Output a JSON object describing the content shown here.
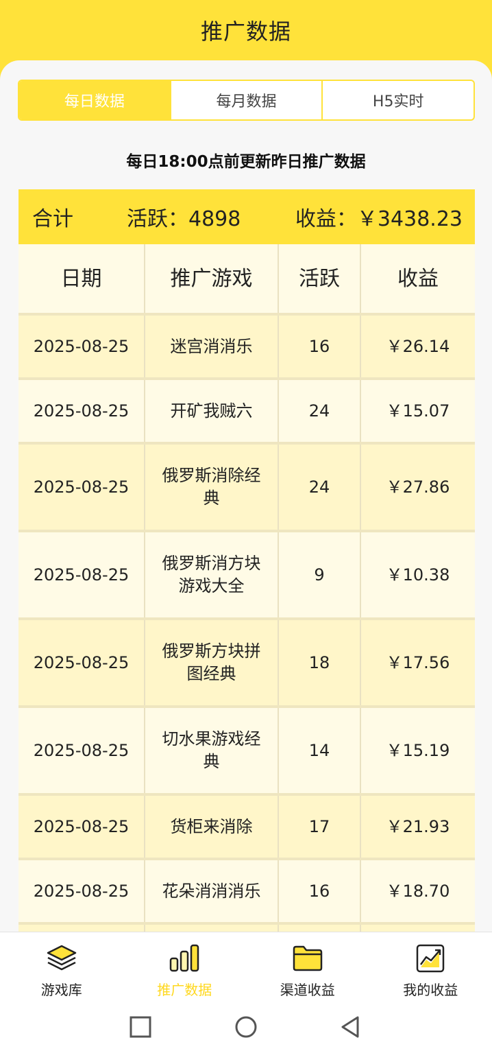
{
  "header": {
    "title": "推广数据"
  },
  "tabs": [
    {
      "label": "每日数据",
      "active": true
    },
    {
      "label": "每月数据",
      "active": false
    },
    {
      "label": "H5实时",
      "active": false
    }
  ],
  "notice": "每日18:00点前更新昨日推广数据",
  "summary": {
    "label": "合计",
    "active": "活跃：4898",
    "income": "收益：￥3438.23"
  },
  "table": {
    "columns": [
      "日期",
      "推广游戏",
      "活跃",
      "收益"
    ],
    "rows": [
      {
        "date": "2025-08-25",
        "game": "迷宫消消乐",
        "active": "16",
        "income": "￥26.14"
      },
      {
        "date": "2025-08-25",
        "game": "开矿我贼六",
        "active": "24",
        "income": "￥15.07"
      },
      {
        "date": "2025-08-25",
        "game": "俄罗斯消除经典",
        "active": "24",
        "income": "￥27.86"
      },
      {
        "date": "2025-08-25",
        "game": "俄罗斯消方块游戏大全",
        "active": "9",
        "income": "￥10.38"
      },
      {
        "date": "2025-08-25",
        "game": "俄罗斯方块拼图经典",
        "active": "18",
        "income": "￥17.56"
      },
      {
        "date": "2025-08-25",
        "game": "切水果游戏经典",
        "active": "14",
        "income": "￥15.19"
      },
      {
        "date": "2025-08-25",
        "game": "货柜来消除",
        "active": "17",
        "income": "￥21.93"
      },
      {
        "date": "2025-08-25",
        "game": "花朵消消消乐",
        "active": "16",
        "income": "￥18.70"
      }
    ]
  },
  "bottom_nav": [
    {
      "label": "游戏库",
      "icon": "layers-icon"
    },
    {
      "label": "推广数据",
      "icon": "bar-chart-icon",
      "active": true
    },
    {
      "label": "渠道收益",
      "icon": "folder-icon"
    },
    {
      "label": "我的收益",
      "icon": "trend-chart-icon"
    }
  ],
  "colors": {
    "accent": "#ffe23a",
    "active_tab_text": "#ffffff",
    "nav_active": "#ffd81f"
  }
}
